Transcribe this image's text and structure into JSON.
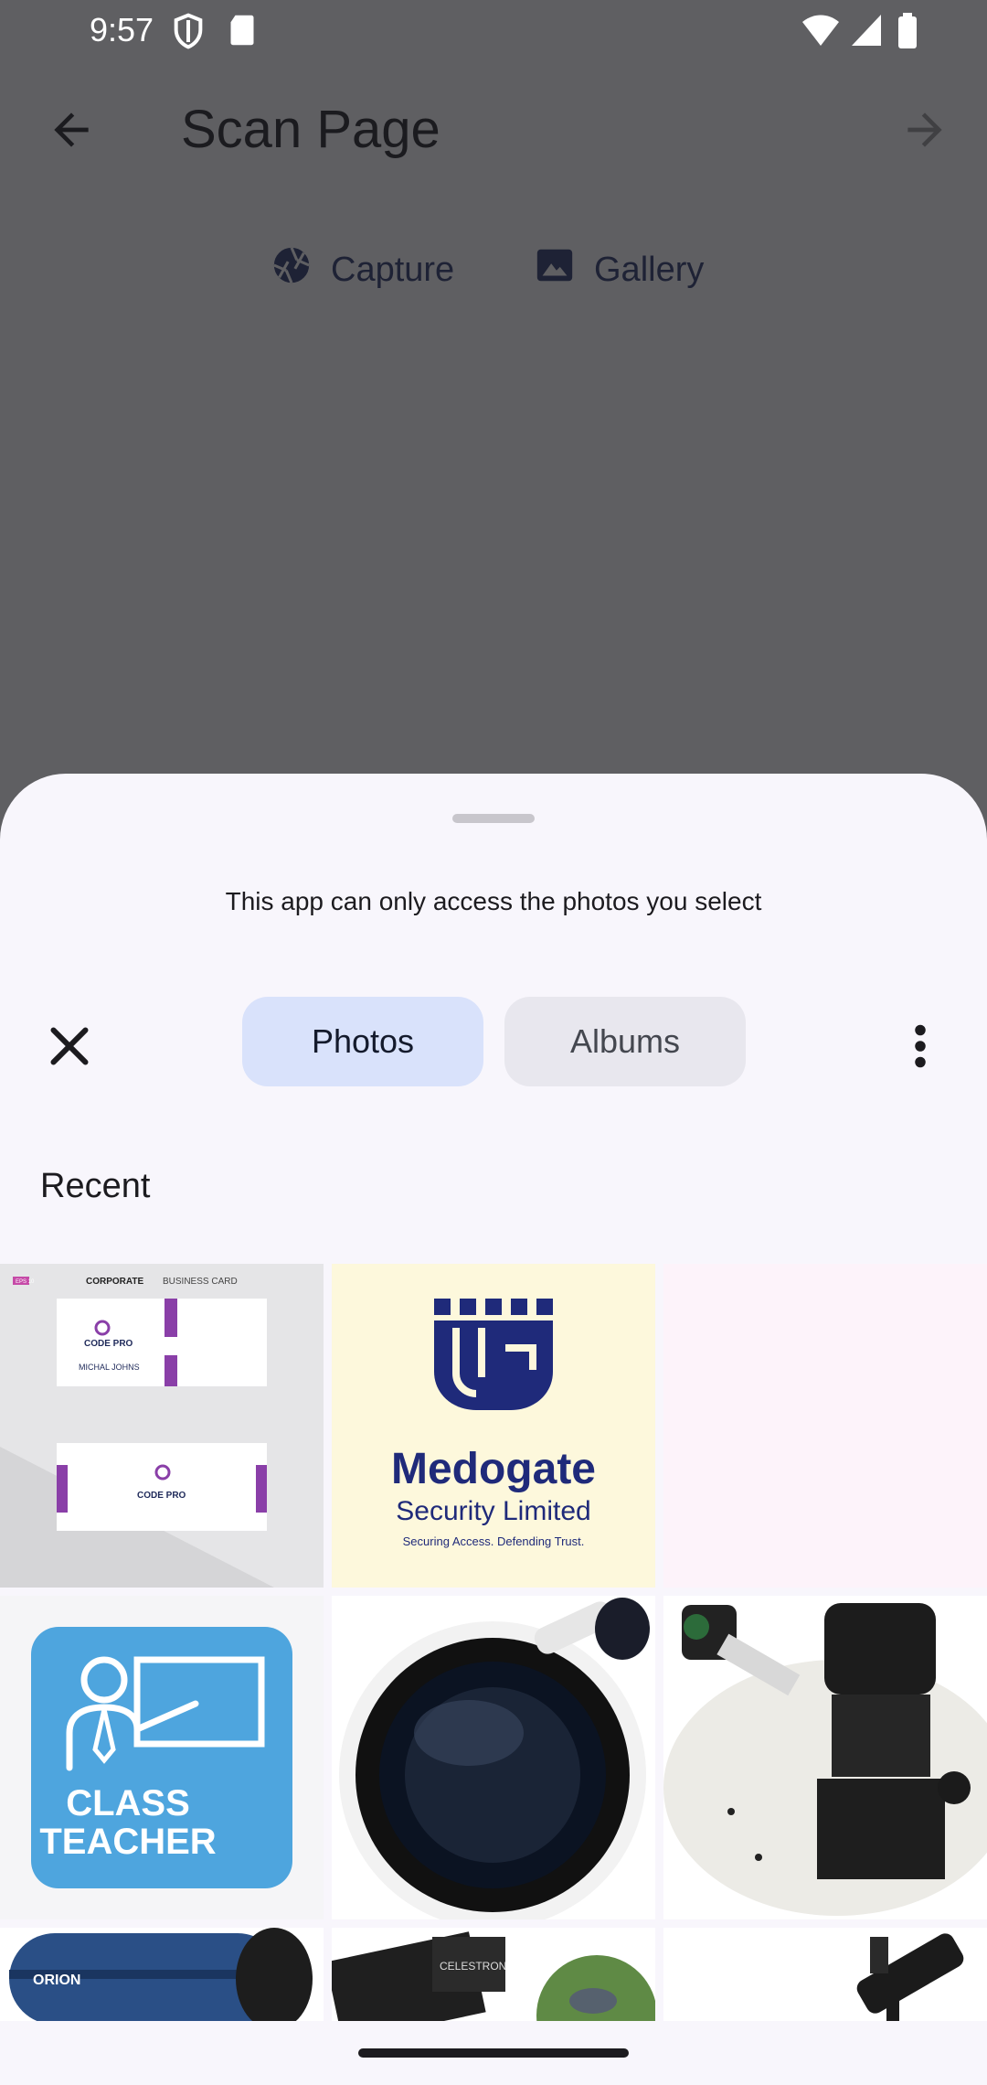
{
  "status_bar": {
    "time": "9:57"
  },
  "app_bar": {
    "title": "Scan Page"
  },
  "source_options": {
    "capture_label": "Capture",
    "gallery_label": "Gallery"
  },
  "picker": {
    "notice": "This app can only access the photos you select",
    "tabs": {
      "photos": "Photos",
      "albums": "Albums"
    },
    "section_label": "Recent",
    "photos": [
      {
        "name": "business-card-thumbnail",
        "texts": [
          "CORPORATE",
          "BUSINESS CARD",
          "CODE PRO",
          "MICHAL JOHNS",
          "CODE PRO",
          "EPS 10"
        ]
      },
      {
        "name": "medogate-logo-thumbnail",
        "texts": [
          "Medogate",
          "Security Limited",
          "Securing Access. Defending Trust."
        ]
      },
      {
        "name": "blank-pink-thumbnail",
        "texts": []
      },
      {
        "name": "class-teacher-thumbnail",
        "texts": [
          "CLASS",
          "TEACHER"
        ]
      },
      {
        "name": "telescope-front-thumbnail",
        "texts": []
      },
      {
        "name": "telescope-eyepiece-thumbnail",
        "texts": []
      },
      {
        "name": "telescope-tube-thumbnail",
        "texts": [
          "ORION"
        ]
      },
      {
        "name": "telescope-bird-thumbnail",
        "texts": [
          "CELESTRON"
        ]
      },
      {
        "name": "telescope-tripod-thumbnail",
        "texts": []
      }
    ]
  },
  "colors": {
    "scrim_background": "#5f5f62",
    "sheet_background": "#f8f6fc",
    "photos_tab_selected": "#d9e2fb",
    "albums_tab": "#e8e7ee",
    "medogate_navy": "#1f2a7a",
    "class_teacher_blue": "#4ea5de"
  }
}
